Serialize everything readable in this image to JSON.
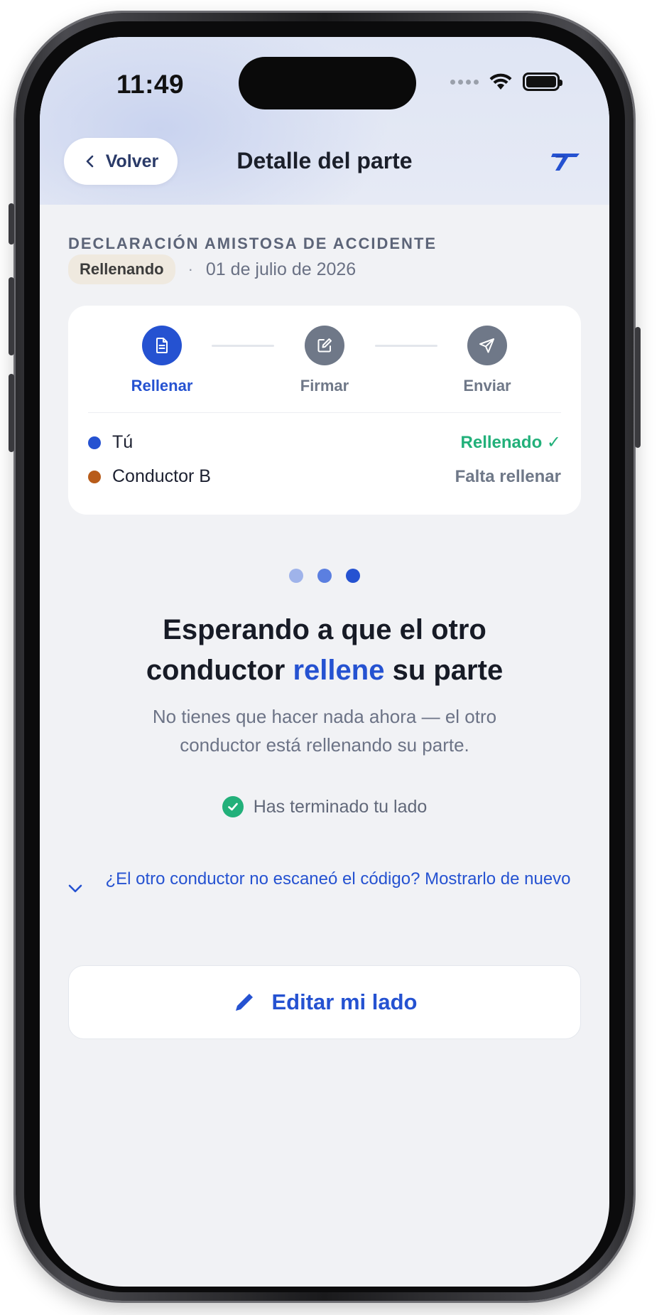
{
  "status_bar": {
    "time": "11:49"
  },
  "header": {
    "back_label": "Volver",
    "title": "Detalle del parte",
    "brand_icon": "brand-logo-icon"
  },
  "document": {
    "kind": "DECLARACIÓN AMISTOSA DE ACCIDENTE",
    "status": "Rellenando",
    "separator": "·",
    "date": "01 de julio de 2026"
  },
  "steps": [
    {
      "label": "Rellenar",
      "icon": "document-icon",
      "state": "active"
    },
    {
      "label": "Firmar",
      "icon": "edit-square-icon",
      "state": "inactive"
    },
    {
      "label": "Enviar",
      "icon": "send-icon",
      "state": "inactive"
    }
  ],
  "parties": [
    {
      "name": "Tú",
      "status": "Rellenado ✓",
      "dot_color": "#2552d1",
      "status_color": "#22b07a"
    },
    {
      "name": "Conductor B",
      "status": "Falta rellenar",
      "dot_color": "#b85c1a",
      "status_color": "#6f7888"
    }
  ],
  "pager": {
    "count": 3,
    "colors": [
      "#9fb3ea",
      "#5b7fe0",
      "#2552d1"
    ]
  },
  "message": {
    "headline_part1": "Esperando a que el otro",
    "headline_part2": "conductor",
    "headline_accent": "rellene",
    "headline_part3": "su parte",
    "subtext": "No tienes que hacer nada ahora — el otro conductor está rellenando su parte."
  },
  "done_text": "Has terminado tu lado",
  "rescan_link": "¿El otro conductor no escaneó el código? Mostrarlo de nuevo",
  "edit_button": "Editar mi lado",
  "colors": {
    "accent": "#2552d1",
    "success": "#22b07a",
    "muted": "#6f7888",
    "background": "#f1f2f5"
  }
}
